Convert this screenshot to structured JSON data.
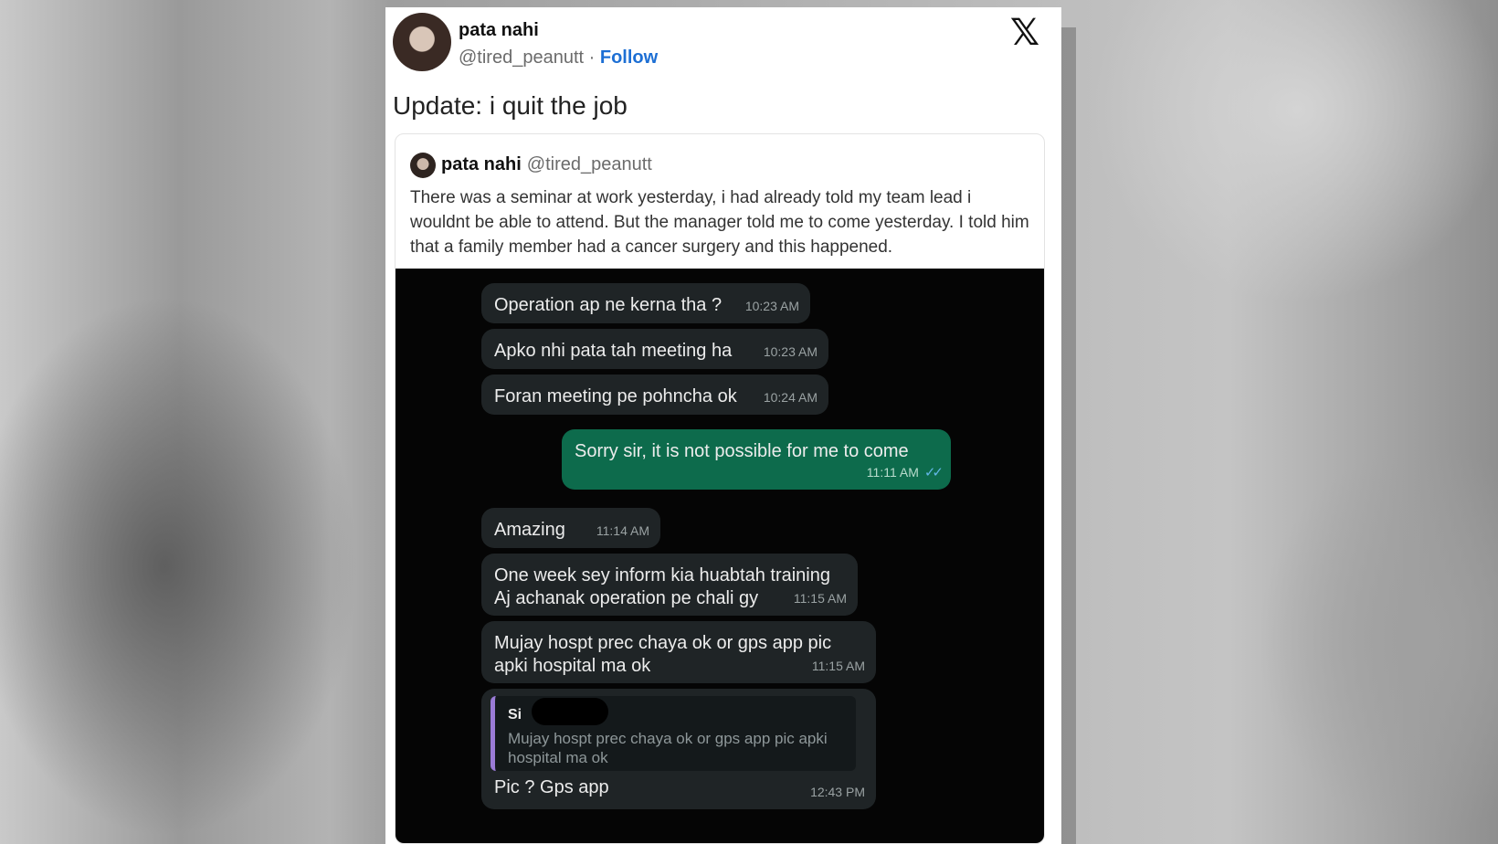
{
  "tweet": {
    "author_name": "pata nahi",
    "author_handle": "@tired_peanutt",
    "separator": "·",
    "follow_label": "Follow",
    "close_icon": "x-logo-icon",
    "text": "Update: i quit the job"
  },
  "quoted_tweet": {
    "author_name": "pata nahi",
    "author_handle": "@tired_peanutt",
    "text": "There was a seminar at work yesterday, i had already told my team lead i wouldnt be able to attend. But the manager told me to come yesterday. I told him that a family member had a cancer surgery and this happened."
  },
  "chat": {
    "messages": [
      {
        "direction": "incoming",
        "text": "Operation ap ne kerna tha ?",
        "time": "10:23 AM"
      },
      {
        "direction": "incoming",
        "text": "Apko nhi pata tah meeting ha",
        "time": "10:23 AM"
      },
      {
        "direction": "incoming",
        "text": "Foran meeting pe pohncha ok",
        "time": "10:24 AM"
      },
      {
        "direction": "outgoing",
        "text": "Sorry sir, it is not possible for me to come",
        "time": "11:11 AM",
        "status_icon": "double-check-icon"
      },
      {
        "direction": "incoming",
        "text": "Amazing",
        "time": "11:14 AM"
      },
      {
        "direction": "incoming",
        "text": "One week sey inform kia huabtah training\nAj achanak operation pe chali gy",
        "time": "11:15 AM"
      },
      {
        "direction": "incoming",
        "text": "Mujay hospt prec chaya ok or gps app pic\napki hospital ma ok",
        "time": "11:15 AM"
      },
      {
        "direction": "incoming",
        "reply_to_sender": "Si",
        "reply_to_text": "Mujay hospt prec chaya ok or gps app pic apki hospital ma ok",
        "text": "Pic ? Gps app",
        "time": "12:43 PM"
      }
    ],
    "colors": {
      "background": "#050505",
      "incoming_bubble": "#1f2426",
      "outgoing_bubble": "#0d6b4c",
      "reply_bar": "#9a7bd6",
      "read_ticks": "#62b6e6"
    }
  }
}
